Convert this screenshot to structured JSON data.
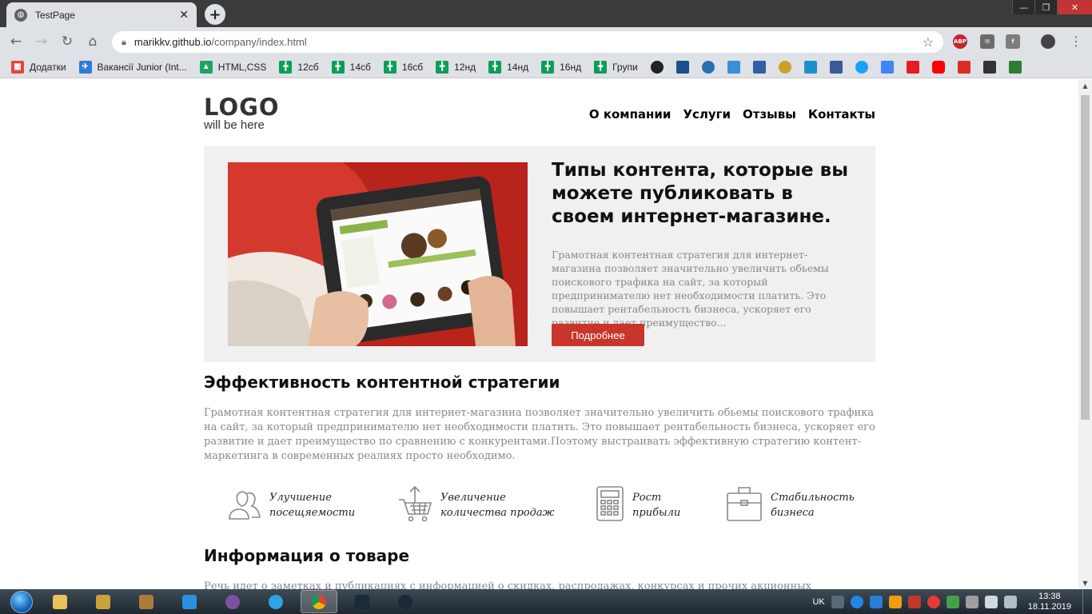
{
  "browser": {
    "tab_title": "TestPage",
    "tab_close": "✕",
    "new_tab": "+",
    "url_host": "marikkv.github.io",
    "url_path": "/company/index.html",
    "bookmarks": [
      {
        "label": "Додатки",
        "color": "#e8453c"
      },
      {
        "label": "Вакансії Junior (Int...",
        "color": "#2c7bd6"
      },
      {
        "label": "HTML,CSS",
        "color": "#1fa463"
      },
      {
        "label": "12сб",
        "color": "#0f9d58"
      },
      {
        "label": "14сб",
        "color": "#0f9d58"
      },
      {
        "label": "16сб",
        "color": "#0f9d58"
      },
      {
        "label": "12нд",
        "color": "#0f9d58"
      },
      {
        "label": "14нд",
        "color": "#0f9d58"
      },
      {
        "label": "16нд",
        "color": "#0f9d58"
      },
      {
        "label": "Групи",
        "color": "#0f9d58"
      }
    ]
  },
  "site": {
    "logo_title": "LOGO",
    "logo_subtitle": "will be here",
    "nav": [
      "О компании",
      "Услуги",
      "Отзывы",
      "Контакты"
    ],
    "hero": {
      "title": "Типы контента, которые вы можете публиковать в своем интернет-магазине.",
      "text": "Грамотная контентная стратегия для интернет-магазина позволяет значительно увеличить обьемы поискового трафика на сайт, за который предпринимателю нет необходимости платить. Это повышает рентабельность бизнеса, ускоряет его развитие и дает преимущество...",
      "button": "Подробнее"
    },
    "section1": {
      "title": "Эффективность контентной стратегии",
      "text": "Грамотная контентная стратегия для интернет-магазина позволяет значительно увеличить обьемы поискового трафика на сайт, за который предпринимателю нет необходимости платить. Это повышает рентабельность бизнеса, ускоряет его развитие и дает преимущество по сравнению с конкурентами.Поэтому выстраивать эффективную стратегию контент-маркетинга в современных реалиях просто необходимо."
    },
    "features": [
      {
        "icon": "people-icon",
        "line1": "Улучшение",
        "line2": "посещяемости"
      },
      {
        "icon": "cart-icon",
        "line1": "Увеличение",
        "line2": "количества продаж"
      },
      {
        "icon": "calculator-icon",
        "line1": "Рост",
        "line2": "прибыли"
      },
      {
        "icon": "briefcase-icon",
        "line1": "Стабильность",
        "line2": "бизнеса"
      }
    ],
    "section2": {
      "title": "Информация о товаре",
      "text": "Речь идет о заметках и публикациях с информацией о скидках, распродажах, конкурсах и прочих акционных"
    }
  },
  "taskbar": {
    "language": "UK",
    "time": "13:38",
    "date": "18.11.2019"
  },
  "colors": {
    "accent_button": "#c8352b",
    "hero_bg": "#f0f0f0",
    "body_text": "#888888"
  }
}
